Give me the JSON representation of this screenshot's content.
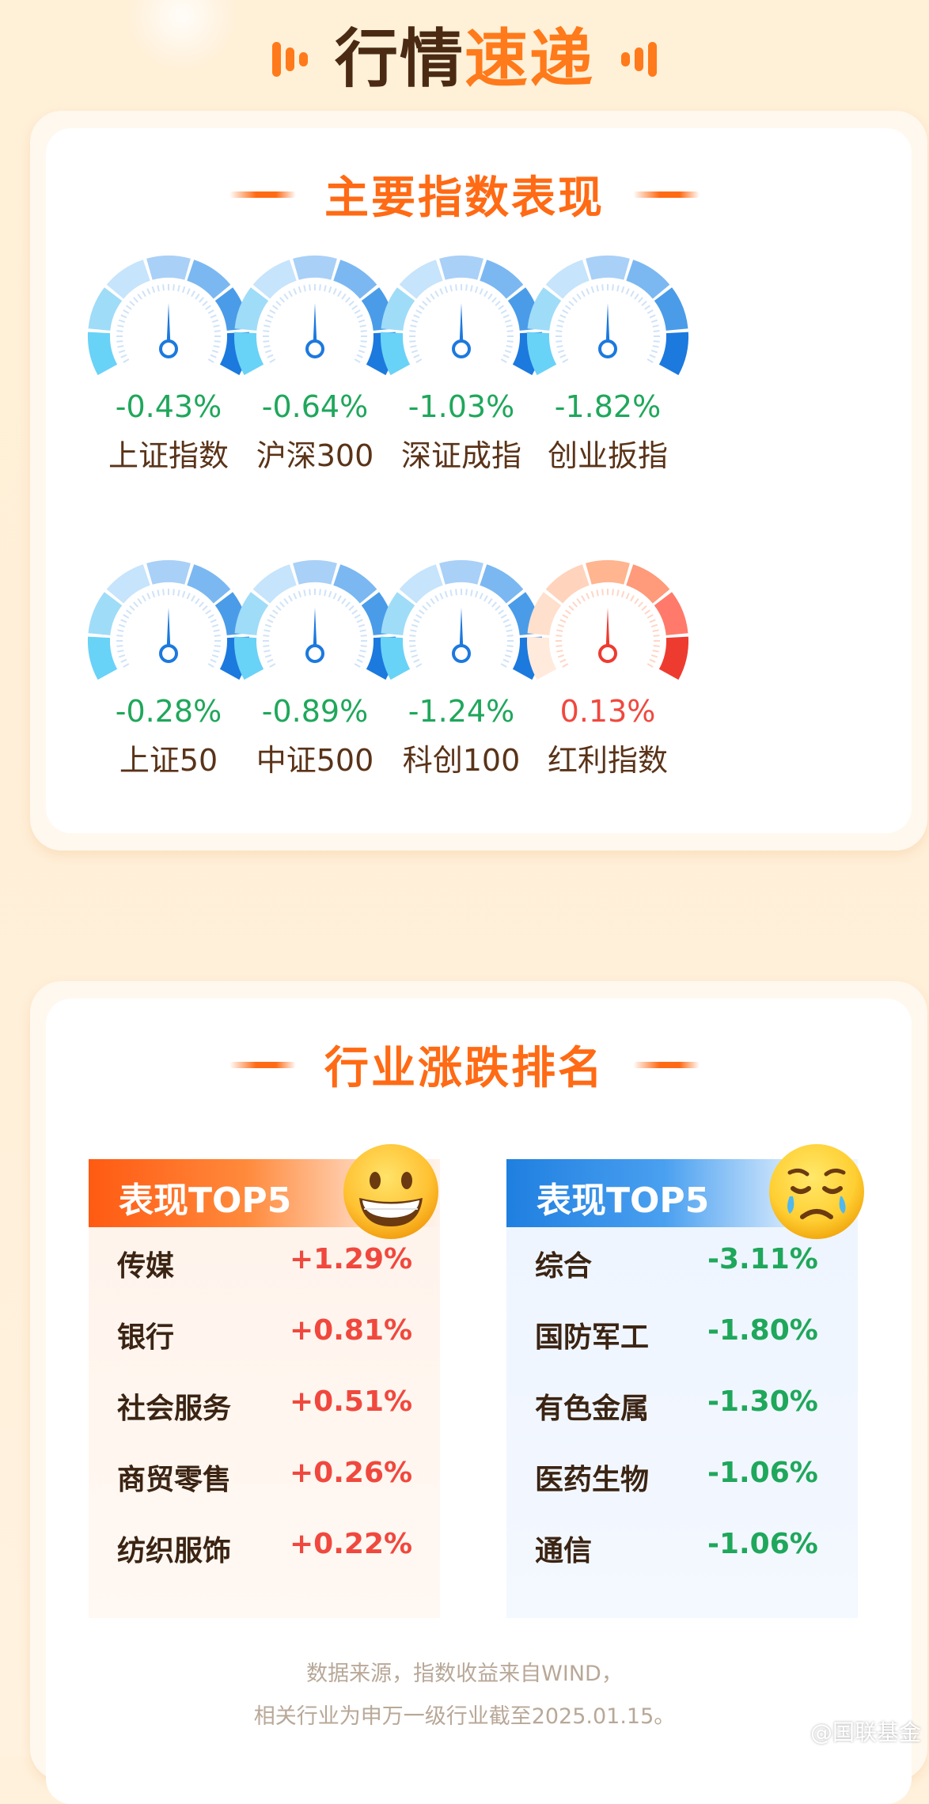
{
  "header": {
    "title_part1": "行情",
    "title_part2": "速递"
  },
  "indices": {
    "title": "主要指数表现",
    "items": [
      {
        "name": "上证指数",
        "change": "-0.43%",
        "direction": "down"
      },
      {
        "name": "沪深300",
        "change": "-0.64%",
        "direction": "down"
      },
      {
        "name": "深证成指",
        "change": "-1.03%",
        "direction": "down"
      },
      {
        "name": "创业扳指",
        "change": "-1.82%",
        "direction": "down"
      },
      {
        "name": "上证50",
        "change": "-0.28%",
        "direction": "down"
      },
      {
        "name": "中证500",
        "change": "-0.89%",
        "direction": "down"
      },
      {
        "name": "科创100",
        "change": "-1.24%",
        "direction": "down"
      },
      {
        "name": "红利指数",
        "change": "0.13%",
        "direction": "up"
      }
    ]
  },
  "industry": {
    "title": "行业涨跌排名",
    "top": {
      "label": "表现TOP5",
      "emoji": "grinning-face-icon",
      "rows": [
        {
          "name": "传媒",
          "value": "+1.29%"
        },
        {
          "name": "银行",
          "value": "+0.81%"
        },
        {
          "name": "社会服务",
          "value": "+0.51%"
        },
        {
          "name": "商贸零售",
          "value": "+0.26%"
        },
        {
          "name": "纺织服饰",
          "value": "+0.22%"
        }
      ]
    },
    "bottom": {
      "label": "表现TOP5",
      "emoji": "sad-tear-face-icon",
      "rows": [
        {
          "name": "综合",
          "value": "-3.11%"
        },
        {
          "name": "国防军工",
          "value": "-1.80%"
        },
        {
          "name": "有色金属",
          "value": "-1.30%"
        },
        {
          "name": "医药生物",
          "value": "-1.06%"
        },
        {
          "name": "通信",
          "value": "-1.06%"
        }
      ]
    }
  },
  "footer": {
    "line1": "数据来源，指数收益来自WIND，",
    "line2": "相关行业为申万一级行业截至2025.01.15。"
  },
  "watermark": "@国联基金",
  "colors": {
    "up": "#f0483e",
    "down": "#1fa75b",
    "accent": "#ff6a14",
    "blue": "#1f7fe0"
  }
}
